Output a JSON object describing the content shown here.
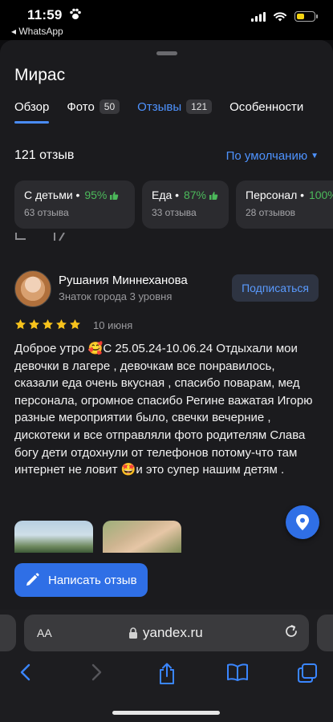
{
  "status_bar": {
    "time": "11:59",
    "back_label": "◂ WhatsApp"
  },
  "place": {
    "title": "Мирас"
  },
  "tabs": [
    {
      "label": "Обзор",
      "count": ""
    },
    {
      "label": "Фото",
      "count": "50"
    },
    {
      "label": "Отзывы",
      "count": "121"
    },
    {
      "label": "Особенности",
      "count": ""
    }
  ],
  "reviews": {
    "count_label": "121 отзыв",
    "sort_label": "По умолчанию"
  },
  "chips": [
    {
      "label": "С детьми •",
      "percent": "95%",
      "sub": "63 отзыва"
    },
    {
      "label": "Еда •",
      "percent": "87%",
      "sub": "33 отзыва"
    },
    {
      "label": "Персонал •",
      "percent": "100%",
      "sub": "28 отзывов"
    }
  ],
  "review": {
    "author": "Рушания Миннеханова",
    "author_level": "Знаток города 3 уровня",
    "subscribe_label": "Подписаться",
    "rating": 5,
    "date": "10 июня",
    "text": "Доброе утро 🥰С 25.05.24-10.06.24 Отдыхали мои девочки в лагере , девочкам все понравилось, сказали еда очень вкусная , спасибо поварам, мед персонала, огромное спасибо Регине важатая Игорю разные мероприятии было, свечки вечерние , дискотеки и все отправляли фото родителям Слава богу дети отдохнули от телефонов потому-что там интернет не ловит 🤩и это супер нашим детям ."
  },
  "write_review_label": "Написать отзыв",
  "browser": {
    "aa": "AA",
    "url": "yandex.ru"
  },
  "colors": {
    "accent": "#2f6fe6",
    "link": "#4e93ff",
    "positive": "#4cba5b",
    "star": "#f6c21c"
  }
}
